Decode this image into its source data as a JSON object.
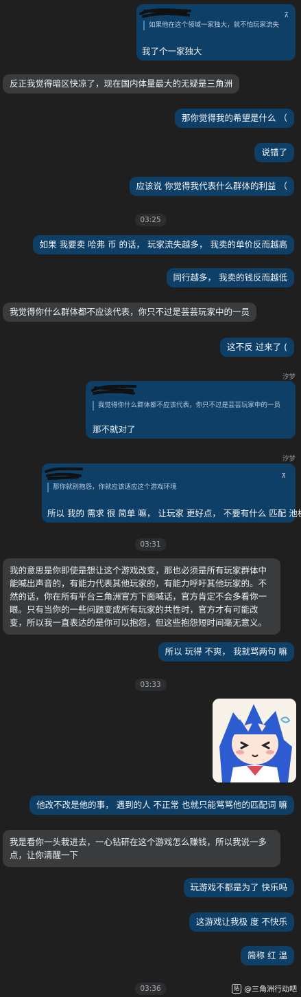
{
  "colors": {
    "background": "#1f1f1f",
    "outgoing_bubble": "#0e3f67",
    "incoming_bubble": "#3a3b3d",
    "timestamp_pill": "#2c2d2f"
  },
  "quote1": {
    "icon": "pin-icon",
    "quoted": "如果他在这个领域一家独大，就不怕玩家流失",
    "reply": "我了个一家独大"
  },
  "m1": "反正我觉得暗区快凉了，现在国内体量最大的无疑是三角洲",
  "m2": "那你觉得我的希望是什么 （",
  "m3": "说错了",
  "m4": "应该说 你觉得我代表什么群体的利益 （",
  "t1": "03:25",
  "m5": "如果 我要卖 哈弗 币 的话， 玩家流失越多， 我卖的单价反而越高",
  "m6": "同行越多， 我卖的钱反而越低",
  "m7": "我觉得你什么群体都不应该代表，你只不过是芸芸玩家中的一员",
  "m8": "这不反 过来了 (",
  "s1": "汐梦",
  "quote2": {
    "quoted": "我觉得你什么群体都不应该代表，你只不过是芸芸玩家中的一员",
    "reply": "那不就对了"
  },
  "s2": "汐梦",
  "quote3": {
    "icon": "pin-icon",
    "quoted": "那你就别抱怨，你就应该适应这个游戏环境",
    "reply": "所以 我的 需求 很 简单 嘛， 让玩家 更好点， 不要有什么 匹配 池机制"
  },
  "t2": "03:31",
  "m9": "我的意思是你即使是想让这个游戏改变，那也必须是所有玩家群体中能喊出声音的，有能力代表其他玩家的，有能力呼吁其他玩家的。不然的话，你在所有平台三角洲官方下面喊话，官方肯定不会多看你一眼。只有当你的一些问题变成所有玩家的共性时，官方才有可能改变，所以我一直表达的是你可以抱怨，但这些抱怨短时间毫无意义。",
  "m10": "所以 玩得 不爽， 我就骂两句 嘛",
  "t3": "03:33",
  "sticker": {
    "icon": "anime-girl-sticker-icon"
  },
  "m11": "他改不改是他的事， 遇到的人 不正常 也就只能骂骂他的匹配词 嘛",
  "m12": "我是看你一头栽进去，一心钻研在这个游戏怎么赚钱，所以我说一多点，让你清醒一下",
  "m13": "玩游戏不都是为了 快乐吗",
  "m14": "这游戏让我极 度 不快乐",
  "m15": "简称 红 温",
  "t4": "03:36",
  "watermark": "@三角洲行动吧"
}
